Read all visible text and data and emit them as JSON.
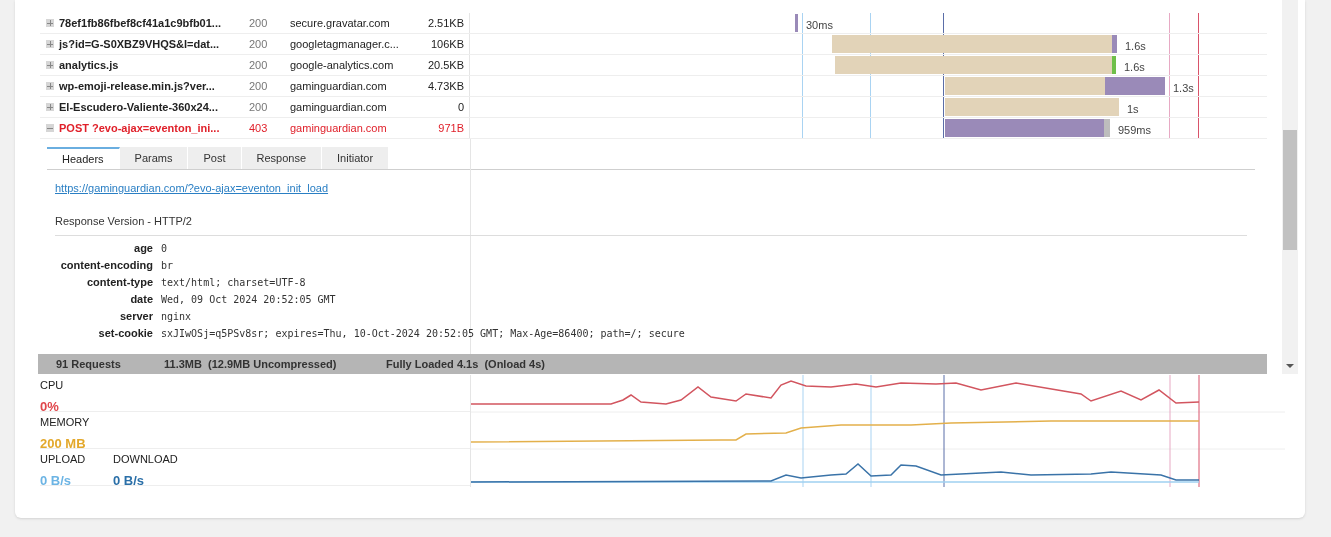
{
  "requests": [
    {
      "name": "78ef1fb86fbef8cf41a1c9bfb01...",
      "status": "200",
      "domain": "secure.gravatar.com",
      "size": "2.51KB",
      "duration": "30ms",
      "expanded": false,
      "error": false
    },
    {
      "name": "js?id=G-S0XBZ9VHQS&l=dat...",
      "status": "200",
      "domain": "googletagmanager.c...",
      "size": "106KB",
      "duration": "1.6s",
      "expanded": false,
      "error": false
    },
    {
      "name": "analytics.js",
      "status": "200",
      "domain": "google-analytics.com",
      "size": "20.5KB",
      "duration": "1.6s",
      "expanded": false,
      "error": false
    },
    {
      "name": "wp-emoji-release.min.js?ver...",
      "status": "200",
      "domain": "gaminguardian.com",
      "size": "4.73KB",
      "duration": "1.3s",
      "expanded": false,
      "error": false
    },
    {
      "name": "El-Escudero-Valiente-360x24...",
      "status": "200",
      "domain": "gaminguardian.com",
      "size": "0",
      "duration": "1s",
      "expanded": false,
      "error": false
    },
    {
      "name": "POST ?evo-ajax=eventon_ini...",
      "status": "403",
      "domain": "gaminguardian.com",
      "size": "971B",
      "duration": "959ms",
      "expanded": true,
      "error": true
    }
  ],
  "details": {
    "tabs": [
      {
        "label": "Headers",
        "selected": true
      },
      {
        "label": "Params",
        "selected": false
      },
      {
        "label": "Post",
        "selected": false
      },
      {
        "label": "Response",
        "selected": false
      },
      {
        "label": "Initiator",
        "selected": false
      }
    ],
    "url": "https://gaminguardian.com/?evo-ajax=eventon_init_load",
    "response_version": "Response Version - HTTP/2",
    "headers": [
      {
        "key": "age",
        "value": "0"
      },
      {
        "key": "content-encoding",
        "value": "br"
      },
      {
        "key": "content-type",
        "value": "text/html; charset=UTF-8"
      },
      {
        "key": "date",
        "value": "Wed, 09 Oct 2024 20:52:05 GMT"
      },
      {
        "key": "server",
        "value": "nginx"
      },
      {
        "key": "set-cookie",
        "value": "sxJIwOSj=q5PSv8sr; expires=Thu, 10-Oct-2024 20:52:05 GMT; Max-Age=86400; path=/; secure"
      }
    ]
  },
  "status_bar": {
    "requests": "91 Requests",
    "size": "11.3MB  (12.9MB Uncompressed)",
    "loaded": "Fully Loaded 4.1s  (Onload 4s)"
  },
  "metrics": [
    {
      "kind": "cpu",
      "label": "CPU",
      "value": "0%"
    },
    {
      "kind": "memory",
      "label": "MEMORY",
      "value": "200 MB"
    },
    {
      "kind": "network",
      "label": "UPLOAD",
      "value": "0 B/s",
      "label_2": "DOWNLOAD",
      "value_2": "0 B/s"
    }
  ]
}
